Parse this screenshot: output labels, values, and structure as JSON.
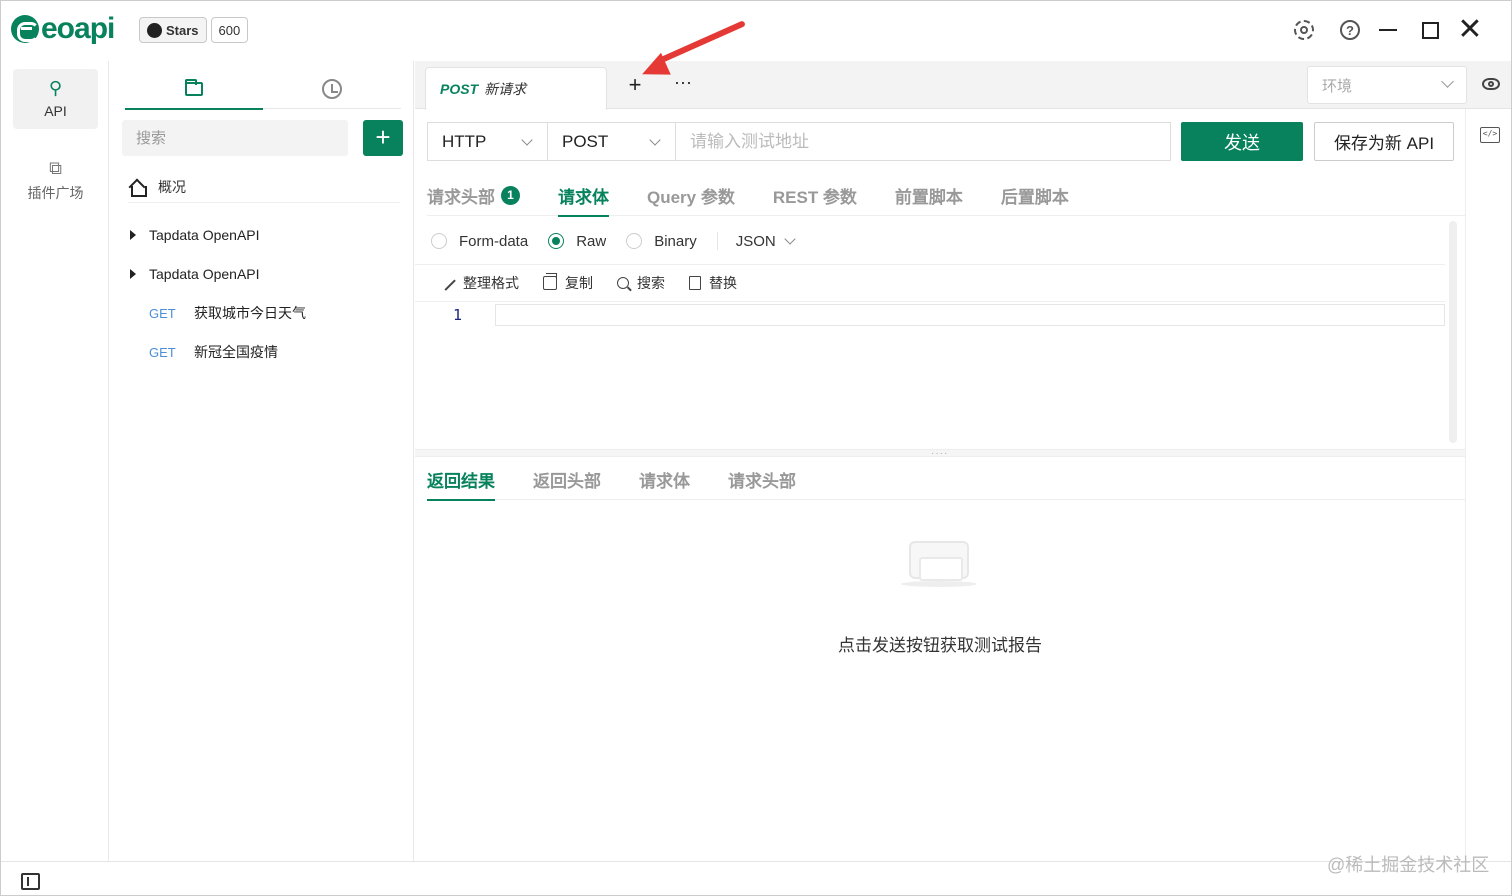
{
  "app": {
    "logo_text": "eoapi",
    "github_stars_label": "Stars",
    "github_stars_count": "600",
    "accent_color": "#07825d"
  },
  "left_nav": {
    "items": [
      {
        "label": "API",
        "icon": "plug-icon",
        "active": true
      },
      {
        "label": "插件广场",
        "icon": "puzzle-icon",
        "active": false
      }
    ]
  },
  "sidebar": {
    "search_placeholder": "搜索",
    "add_label": "+",
    "overview_label": "概况",
    "groups": [
      {
        "label": "Tapdata OpenAPI"
      },
      {
        "label": "Tapdata OpenAPI"
      }
    ],
    "apis": [
      {
        "method": "GET",
        "name": "获取城市今日天气"
      },
      {
        "method": "GET",
        "name": "新冠全国疫情"
      }
    ]
  },
  "tabs": {
    "active_method": "POST",
    "active_name": "新请求",
    "add_label": "+",
    "more_label": "···",
    "env_placeholder": "环境"
  },
  "request": {
    "protocol": "HTTP",
    "method": "POST",
    "url_placeholder": "请输入测试地址",
    "send_label": "发送",
    "save_label": "保存为新 API",
    "tabs": [
      {
        "label": "请求头部",
        "badge": "1",
        "active": false
      },
      {
        "label": "请求体",
        "active": true
      },
      {
        "label": "Query 参数",
        "active": false
      },
      {
        "label": "REST 参数",
        "active": false
      },
      {
        "label": "前置脚本",
        "active": false
      },
      {
        "label": "后置脚本",
        "active": false
      }
    ],
    "body_types": [
      {
        "label": "Form-data",
        "selected": false
      },
      {
        "label": "Raw",
        "selected": true
      },
      {
        "label": "Binary",
        "selected": false
      }
    ],
    "raw_format": "JSON",
    "toolbar": {
      "format_label": "整理格式",
      "copy_label": "复制",
      "search_label": "搜索",
      "replace_label": "替换"
    },
    "editor_line_number": "1"
  },
  "response": {
    "tabs": [
      {
        "label": "返回结果",
        "active": true
      },
      {
        "label": "返回头部",
        "active": false
      },
      {
        "label": "请求体",
        "active": false
      },
      {
        "label": "请求头部",
        "active": false
      }
    ],
    "empty_text": "点击发送按钮获取测试报告"
  },
  "watermark": "@稀土掘金技术社区"
}
